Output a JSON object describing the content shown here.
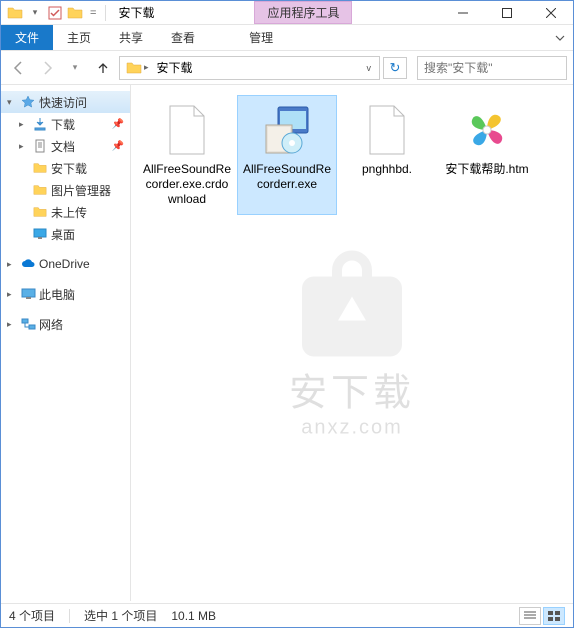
{
  "title": "安下载",
  "context_tab": "应用程序工具",
  "ribbon": {
    "file": "文件",
    "home": "主页",
    "share": "共享",
    "view": "查看",
    "manage": "管理"
  },
  "address": {
    "segment": "安下载",
    "search_placeholder": "搜索\"安下载\""
  },
  "sidebar": {
    "quick_access": "快速访问",
    "items": [
      {
        "label": "下载",
        "pinned": true,
        "type": "downloads"
      },
      {
        "label": "文档",
        "pinned": true,
        "type": "docs"
      },
      {
        "label": "安下载",
        "pinned": false,
        "type": "folder"
      },
      {
        "label": "图片管理器",
        "pinned": false,
        "type": "folder"
      },
      {
        "label": "未上传",
        "pinned": false,
        "type": "folder"
      },
      {
        "label": "桌面",
        "pinned": false,
        "type": "desktop"
      }
    ],
    "onedrive": "OneDrive",
    "this_pc": "此电脑",
    "network": "网络"
  },
  "files": [
    {
      "name": "AllFreeSoundRecorder.exe.crdownload",
      "type": "blank",
      "selected": false
    },
    {
      "name": "AllFreeSoundRecorderr.exe",
      "type": "exe",
      "selected": true
    },
    {
      "name": "pnghhbd.",
      "type": "blank",
      "selected": false
    },
    {
      "name": "安下载帮助.htm",
      "type": "htm",
      "selected": false
    }
  ],
  "status": {
    "count": "4 个项目",
    "selection": "选中 1 个项目",
    "size": "10.1 MB"
  },
  "watermark": {
    "line1": "安下载",
    "line2": "anxz.com"
  }
}
